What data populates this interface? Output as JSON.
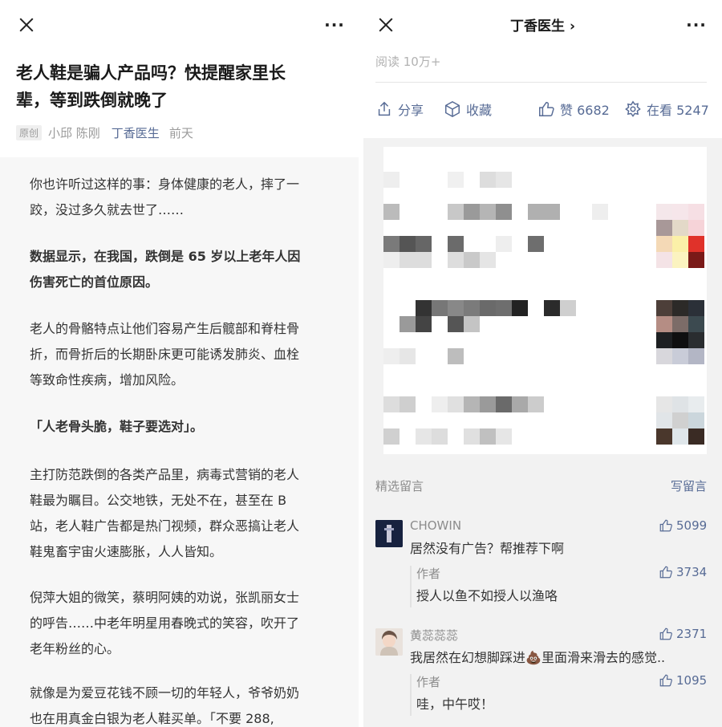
{
  "left": {
    "article": {
      "title_line1": "老人鞋是骗人产品吗？快提醒家里长",
      "title_line2": "辈，等到跌倒就晚了",
      "badge": "原创",
      "authors": "小邱 陈刚",
      "account": "丁香医生",
      "time": "前天",
      "paragraphs": [
        [
          "你也许听过这样的事：身体健康的老人，摔了一",
          "跤，没过多久就去世了……"
        ],
        [
          "数据显示，在我国，跌倒是 65 岁以上老年人因",
          "伤害死亡的首位原因。"
        ],
        [
          "老人的骨骼特点让他们容易产生后髋部和脊柱骨",
          "折，而骨折后的长期卧床更可能诱发肺炎、血栓",
          "等致命性疾病，增加风险。"
        ],
        [
          "「人老骨头脆，鞋子要选对」。"
        ],
        [
          "主打防范跌倒的各类产品里，病毒式营销的老人",
          "鞋最为瞩目。公交地铁，无处不在，甚至在 B",
          "站，老人鞋广告都是热门视频，群众恶搞让老人",
          "鞋鬼畜宇宙火速膨胀，人人皆知。"
        ],
        [
          "倪萍大姐的微笑，蔡明阿姨的劝说，张凯丽女士",
          "的呼告……中老年明星用春晚式的笑容，吹开了",
          "老年粉丝的心。"
        ],
        [
          "就像是为爱豆花钱不顾一切的年轻人，爷爷奶奶",
          "也在用真金白银为老人鞋买单。「不要 288,"
        ]
      ]
    }
  },
  "right": {
    "title": "丁香医生",
    "title_chevron": "›",
    "read_count": "阅读 10万+",
    "actions": {
      "share": "分享",
      "collect": "收藏",
      "like": "赞 6682",
      "view": "在看 5247"
    },
    "comments_header": "精选留言",
    "write_comment": "写留言",
    "comments": [
      {
        "nick": "CHOWIN",
        "text": "居然没有广告？帮推荐下啊",
        "likes": "5099",
        "reply_author": "作者",
        "reply_text": "授人以鱼不如授人以渔咯",
        "reply_likes": "3734"
      },
      {
        "nick": "黄蕊蕊蕊",
        "text": "我居然在幻想脚踩进",
        "emoji": "💩",
        "text_after": "里面滑来滑去的感觉..",
        "likes": "2371",
        "reply_author": "作者",
        "reply_text": "哇，中午哎！",
        "reply_likes": "1095"
      }
    ]
  },
  "icons": {
    "close": "close-icon",
    "more": "more-icon",
    "share": "share-icon",
    "collect": "collect-icon",
    "like": "thumbs-up-icon",
    "view": "wow-icon"
  },
  "colors": {
    "link": "#576b95",
    "muted": "#8c8c8c",
    "background_gray": "#f2f2f2"
  }
}
